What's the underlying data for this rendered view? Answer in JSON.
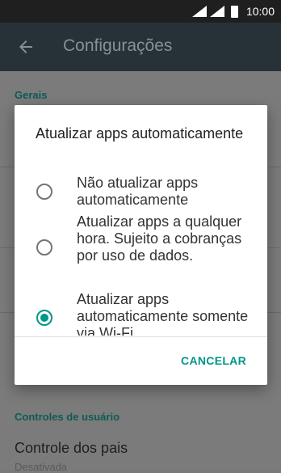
{
  "status": {
    "time": "10:00"
  },
  "appbar": {
    "title": "Configurações"
  },
  "settings": {
    "section_general": "Gerais",
    "section_user_controls": "Controles de usuário",
    "parental_title": "Controle dos pais",
    "parental_status": "Desativada"
  },
  "dialog": {
    "title": "Atualizar apps automaticamente",
    "options": [
      {
        "label": "Não atualizar apps automaticamente",
        "selected": false
      },
      {
        "label": "Atualizar apps a qualquer hora. Sujeito a cobranças por uso de dados.",
        "selected": false
      },
      {
        "label": "Atualizar apps automaticamente somente via Wi-Fi.",
        "selected": true
      }
    ],
    "cancel_label": "CANCELAR",
    "accent_color": "#009688"
  }
}
